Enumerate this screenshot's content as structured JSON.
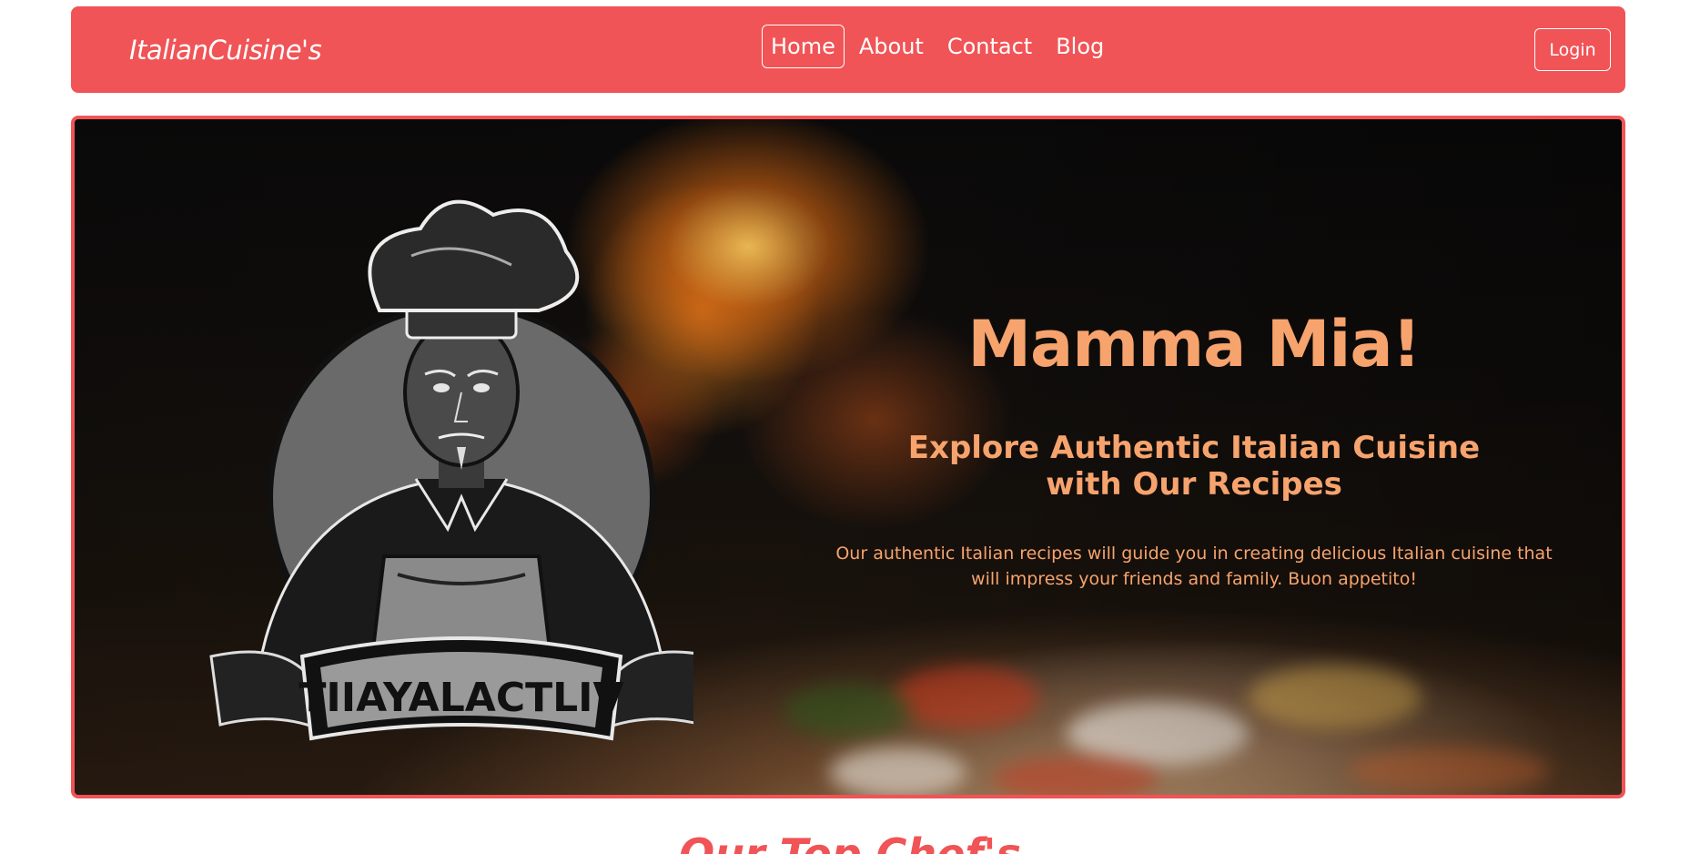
{
  "navbar": {
    "brand": "ItalianCuisine's",
    "links": [
      {
        "label": "Home",
        "active": true
      },
      {
        "label": "About",
        "active": false
      },
      {
        "label": "Contact",
        "active": false
      },
      {
        "label": "Blog",
        "active": false
      }
    ],
    "login_label": "Login"
  },
  "hero": {
    "title": "Mamma Mia!",
    "subtitle": "Explore Authentic Italian Cuisine with Our Recipes",
    "description": "Our authentic Italian recipes will guide you in creating delicious Italian cuisine that will impress your friends and family. Buon appetito!",
    "logo_banner_text": "TIIAYALACTLIV"
  },
  "section": {
    "title": "Our Top Chef's"
  },
  "colors": {
    "accent": "#f05456",
    "hero_text": "#f7a36d"
  }
}
